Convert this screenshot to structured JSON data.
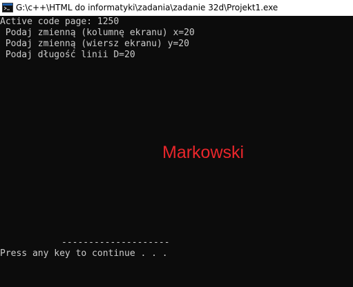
{
  "window": {
    "title": "G:\\c++\\HTML do informatyki\\zadania\\zadanie 32d\\Projekt1.exe",
    "icon": "console-app-icon"
  },
  "console": {
    "lines": [
      "Active code page: 1250",
      " Podaj zmienną (kolumnę ekranu) x=20",
      " Podaj zmienną (wiersz ekranu) y=20",
      " Podaj długość linii D=20"
    ],
    "drawn_line": "--------------------",
    "watermark": "Markowski",
    "prompt": "Press any key to continue . . ."
  },
  "colors": {
    "background": "#0c0c0c",
    "text": "#cccccc",
    "watermark": "#e8262b",
    "titlebar": "#ffffff"
  }
}
